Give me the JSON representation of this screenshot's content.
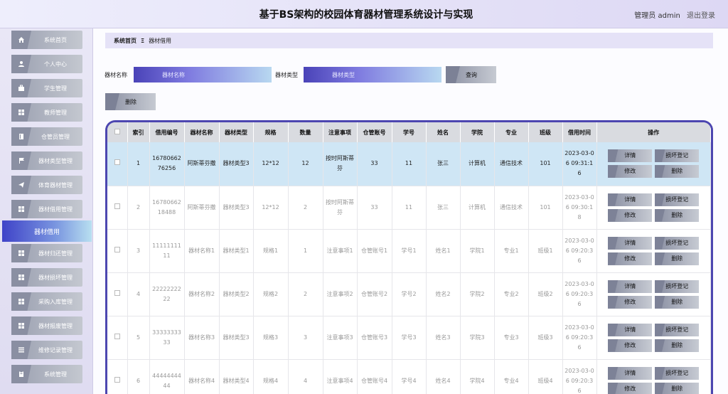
{
  "header": {
    "title": "基于BS架构的校园体育器材管理系统设计与实现",
    "user": "管理员 admin",
    "logout": "退出登录"
  },
  "sidebar": {
    "items": [
      {
        "label": "系统首页",
        "icon": "home-icon"
      },
      {
        "label": "个人中心",
        "icon": "user-icon"
      },
      {
        "label": "学生管理",
        "icon": "briefcase-icon"
      },
      {
        "label": "教师管理",
        "icon": "grid-icon"
      },
      {
        "label": "仓管员管理",
        "icon": "book-icon"
      },
      {
        "label": "器材类型管理",
        "icon": "flag-icon"
      },
      {
        "label": "体育器材管理",
        "icon": "send-icon"
      },
      {
        "label": "器材借用管理",
        "icon": "grid-icon"
      },
      {
        "label": "器材归还管理",
        "icon": "grid-icon"
      },
      {
        "label": "器材损坏管理",
        "icon": "grid-icon"
      },
      {
        "label": "采购入库管理",
        "icon": "grid-icon"
      },
      {
        "label": "器材报废管理",
        "icon": "grid-icon"
      },
      {
        "label": "维修记录管理",
        "icon": "list-icon"
      },
      {
        "label": "系统管理",
        "icon": "clipboard-icon"
      }
    ],
    "active": "器材借用"
  },
  "breadcrumb": {
    "home": "系统首页",
    "sep": "Ξ",
    "current": "器材借用"
  },
  "search": {
    "name_label": "器材名称",
    "name_placeholder": "器材名称",
    "type_label": "器材类型",
    "type_placeholder": "器材类型",
    "query": "查询",
    "delete": "删除"
  },
  "table": {
    "headers": [
      "索引",
      "借用编号",
      "器材名称",
      "器材类型",
      "规格",
      "数量",
      "注意事项",
      "仓管账号",
      "学号",
      "姓名",
      "学院",
      "专业",
      "班级",
      "借用时间",
      "操作"
    ],
    "actions": [
      "详情",
      "损坏登记",
      "修改",
      "删除"
    ],
    "rows": [
      [
        "1",
        "1678066276256",
        "阿斯蒂芬撒",
        "器材类型3",
        "12*12",
        "12",
        "按时阿斯蒂芬",
        "33",
        "11",
        "张三",
        "计算机",
        "通信技术",
        "101",
        "2023-03-06 09:31:16"
      ],
      [
        "2",
        "1678066218488",
        "阿斯蒂芬撒",
        "器材类型3",
        "12*12",
        "2",
        "按时阿斯蒂芬",
        "33",
        "11",
        "张三",
        "计算机",
        "通信技术",
        "101",
        "2023-03-06 09:30:18"
      ],
      [
        "3",
        "1111111111",
        "器材名称1",
        "器材类型1",
        "规格1",
        "1",
        "注意事项1",
        "仓管账号1",
        "学号1",
        "姓名1",
        "学院1",
        "专业1",
        "班级1",
        "2023-03-06 09:20:36"
      ],
      [
        "4",
        "2222222222",
        "器材名称2",
        "器材类型2",
        "规格2",
        "2",
        "注意事项2",
        "仓管账号2",
        "学号2",
        "姓名2",
        "学院2",
        "专业2",
        "班级2",
        "2023-03-06 09:20:36"
      ],
      [
        "5",
        "3333333333",
        "器材名称3",
        "器材类型3",
        "规格3",
        "3",
        "注意事项3",
        "仓管账号3",
        "学号3",
        "姓名3",
        "学院3",
        "专业3",
        "班级3",
        "2023-03-06 09:20:36"
      ],
      [
        "6",
        "4444444444",
        "器材名称4",
        "器材类型4",
        "规格4",
        "4",
        "注意事项4",
        "仓管账号4",
        "学号4",
        "姓名4",
        "学院4",
        "专业4",
        "班级4",
        "2023-03-06 09:20:36"
      ]
    ]
  }
}
